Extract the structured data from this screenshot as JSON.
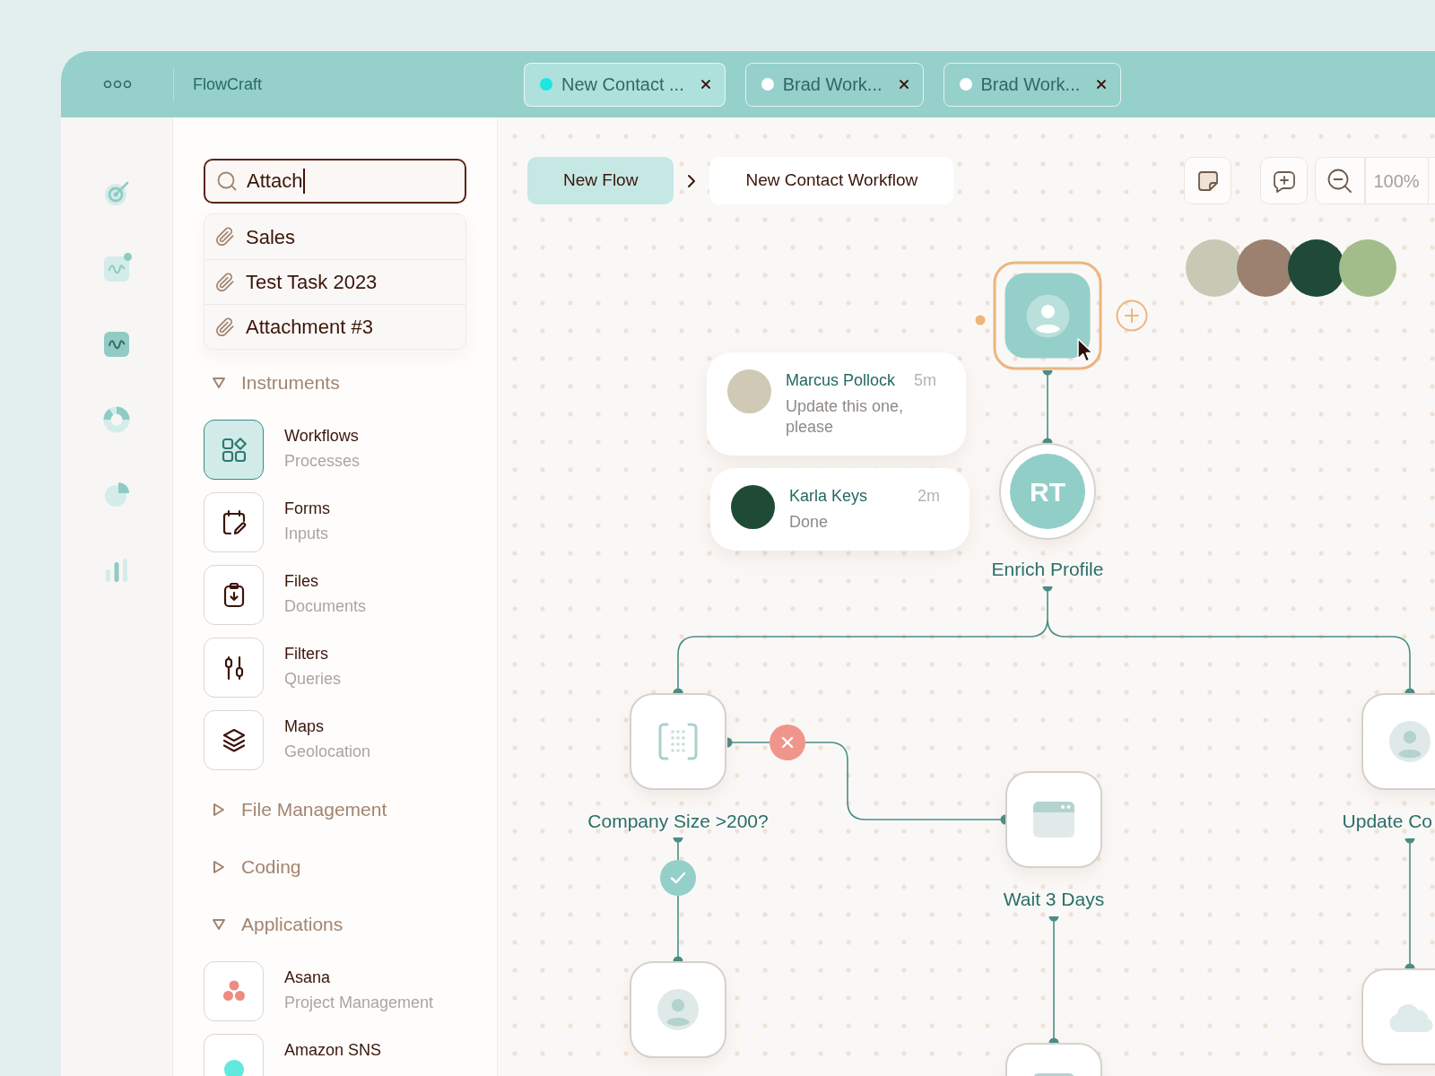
{
  "window": {
    "app_name": "FlowCraft"
  },
  "tabs": [
    {
      "label": "New Contact ...",
      "selected": true
    },
    {
      "label": "Brad Work...",
      "selected": false
    },
    {
      "label": "Brad Work...",
      "selected": false
    }
  ],
  "rail": [
    {
      "kind": "target",
      "selected": false,
      "badge": false
    },
    {
      "kind": "pulse",
      "selected": false,
      "badge": true
    },
    {
      "kind": "pulse",
      "selected": true,
      "badge": false
    },
    {
      "kind": "donut",
      "selected": false,
      "badge": false
    },
    {
      "kind": "pie",
      "selected": false,
      "badge": false
    },
    {
      "kind": "bars",
      "selected": false,
      "badge": false
    }
  ],
  "search": {
    "value": "Attach"
  },
  "suggestions": [
    {
      "label": "Sales"
    },
    {
      "label": "Test Task 2023"
    },
    {
      "label": "Attachment #3"
    }
  ],
  "sections": [
    {
      "title": "Instruments",
      "expanded": true,
      "items": [
        {
          "kind": "shapes",
          "title": "Workflows",
          "subtitle": "Processes",
          "selected": true
        },
        {
          "kind": "form",
          "title": "Forms",
          "subtitle": "Inputs",
          "selected": false
        },
        {
          "kind": "file",
          "title": "Files",
          "subtitle": "Documents",
          "selected": false
        },
        {
          "kind": "filter",
          "title": "Filters",
          "subtitle": "Queries",
          "selected": false
        },
        {
          "kind": "map",
          "title": "Maps",
          "subtitle": "Geolocation",
          "selected": false
        }
      ]
    },
    {
      "title": "File Management",
      "expanded": false
    },
    {
      "title": "Coding",
      "expanded": false
    },
    {
      "title": "Applications",
      "expanded": true,
      "items": [
        {
          "kind": "asana",
          "title": "Asana",
          "subtitle": "Project Management",
          "selected": false
        },
        {
          "kind": "sns",
          "title": "Amazon SNS",
          "selected": false
        }
      ]
    }
  ],
  "breadcrumb": [
    {
      "label": "New Flow",
      "kind": "parent"
    },
    {
      "label": "New Contact Workflow",
      "kind": "current"
    }
  ],
  "toolbar": {
    "zoom": "100%"
  },
  "collaborators": [
    {
      "color": "#c8c9b5"
    },
    {
      "color": "#9c8070"
    },
    {
      "color": "#1e4a37"
    },
    {
      "color": "#a3bd8a"
    }
  ],
  "comments": [
    {
      "author": "Marcus Pollock",
      "time": "5m",
      "text": "Update this one, please",
      "color": "#cfc9b6"
    },
    {
      "author": "Karla Keys",
      "time": "2m",
      "text": "Done",
      "color": "#1f4b36"
    }
  ],
  "flow": {
    "nodes": [
      {
        "kind": "trigger",
        "selected": true
      },
      {
        "kind": "initials",
        "initials": "RT",
        "label": "Enrich Profile"
      },
      {
        "kind": "condition",
        "label": "Company Size >200?"
      },
      {
        "kind": "delay",
        "label": "Wait 3 Days"
      },
      {
        "kind": "contact",
        "label": "Update Co"
      },
      {
        "kind": "contact"
      },
      {
        "kind": "delay"
      },
      {
        "kind": "cloud"
      }
    ],
    "outcomes": [
      {
        "kind": "rejected"
      },
      {
        "kind": "accepted"
      }
    ]
  }
}
